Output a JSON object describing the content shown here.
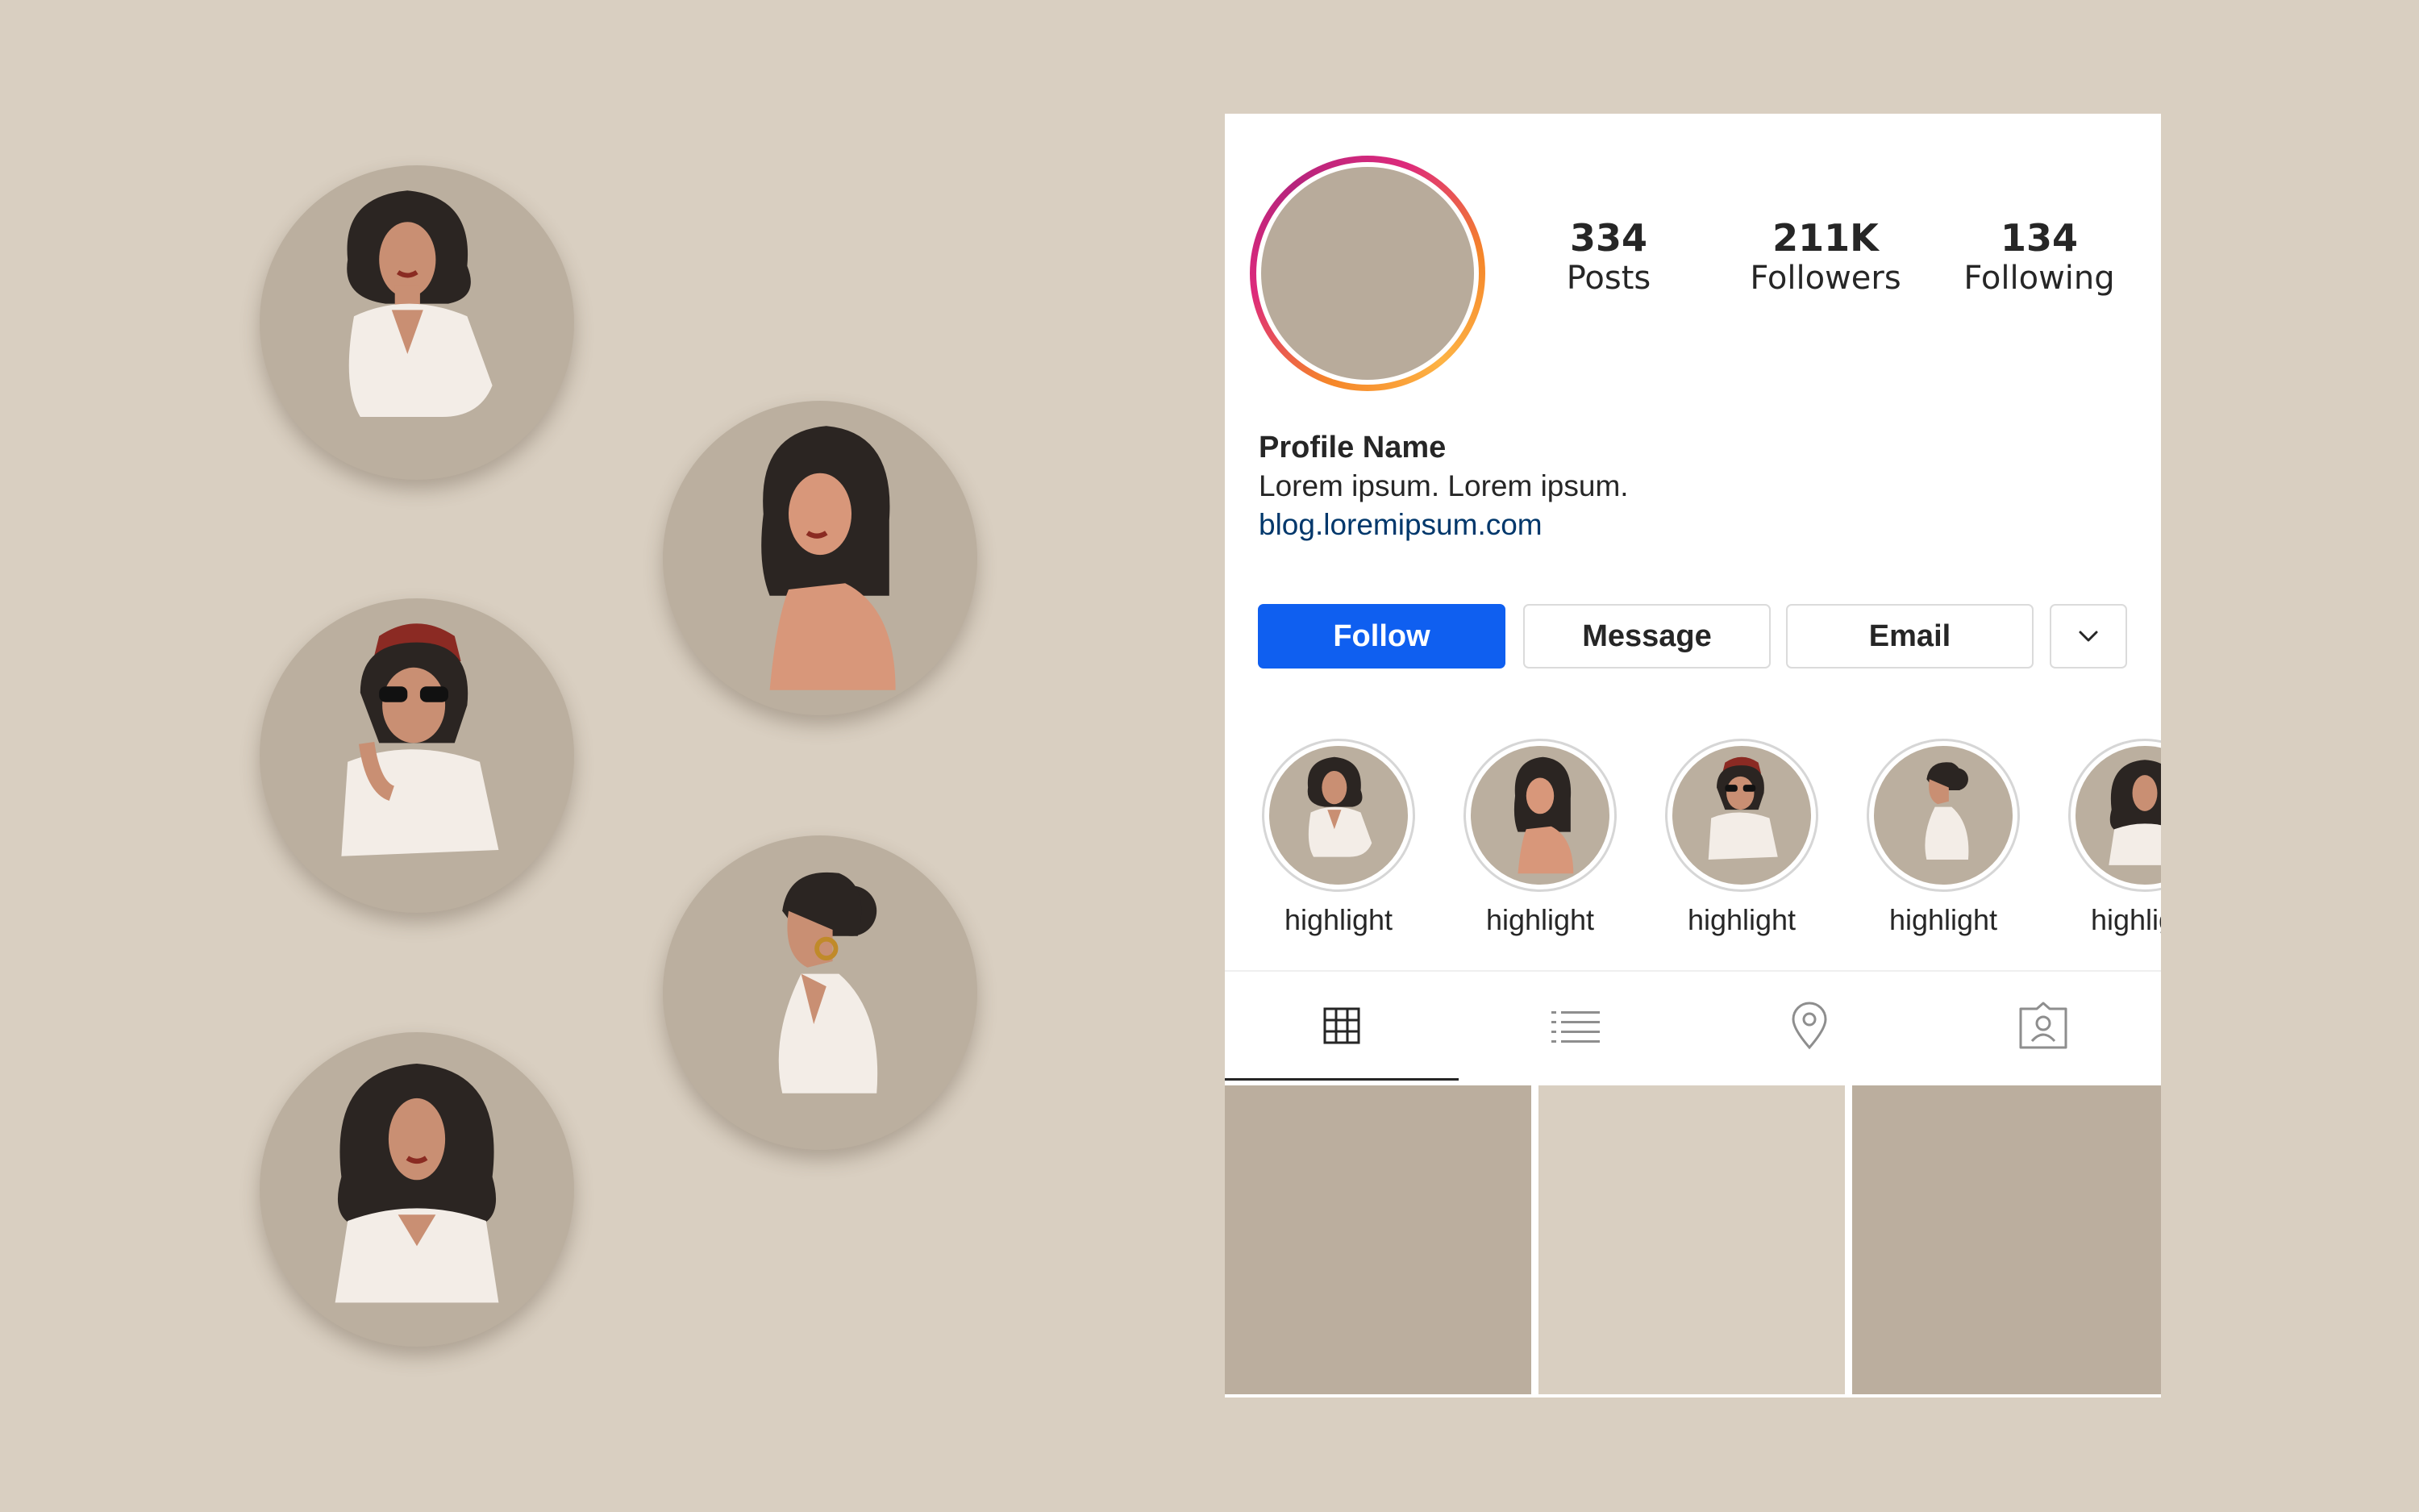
{
  "profile": {
    "stats": [
      {
        "value": "334",
        "label": "Posts"
      },
      {
        "value": "211K",
        "label": "Followers"
      },
      {
        "value": "134",
        "label": "Following"
      }
    ],
    "name": "Profile Name",
    "bio": "Lorem ipsum. Lorem ipsum.",
    "link": "blog.loremipsum.com"
  },
  "buttons": {
    "follow": "Follow",
    "message": "Message",
    "email": "Email",
    "more_icon": "chevron-down-icon"
  },
  "highlights": [
    {
      "label": "highlight"
    },
    {
      "label": "highlight"
    },
    {
      "label": "highlight"
    },
    {
      "label": "highlight"
    },
    {
      "label": "highlight"
    }
  ],
  "tabs": [
    {
      "icon": "grid-icon",
      "active": true
    },
    {
      "icon": "list-icon",
      "active": false
    },
    {
      "icon": "location-pin-icon",
      "active": false
    },
    {
      "icon": "tagged-person-icon",
      "active": false
    }
  ],
  "colors": {
    "background": "#d9cfc1",
    "accent_blue": "#0f5ff0",
    "link": "#00376b",
    "tile_dark": "#bbae9e",
    "tile_light": "#d9cfc1"
  }
}
